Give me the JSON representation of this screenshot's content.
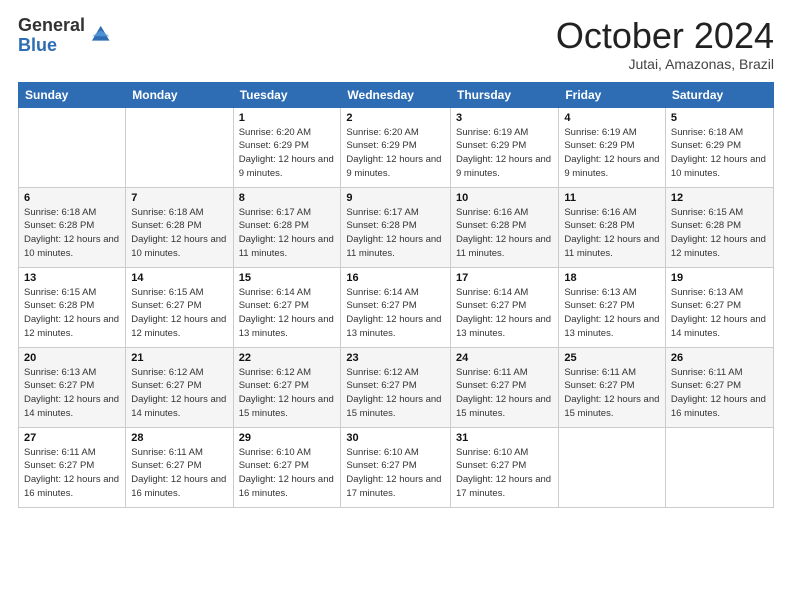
{
  "header": {
    "logo_general": "General",
    "logo_blue": "Blue",
    "month_title": "October 2024",
    "location": "Jutai, Amazonas, Brazil"
  },
  "weekdays": [
    "Sunday",
    "Monday",
    "Tuesday",
    "Wednesday",
    "Thursday",
    "Friday",
    "Saturday"
  ],
  "weeks": [
    [
      {
        "day": "",
        "info": ""
      },
      {
        "day": "",
        "info": ""
      },
      {
        "day": "1",
        "info": "Sunrise: 6:20 AM\nSunset: 6:29 PM\nDaylight: 12 hours and 9 minutes."
      },
      {
        "day": "2",
        "info": "Sunrise: 6:20 AM\nSunset: 6:29 PM\nDaylight: 12 hours and 9 minutes."
      },
      {
        "day": "3",
        "info": "Sunrise: 6:19 AM\nSunset: 6:29 PM\nDaylight: 12 hours and 9 minutes."
      },
      {
        "day": "4",
        "info": "Sunrise: 6:19 AM\nSunset: 6:29 PM\nDaylight: 12 hours and 9 minutes."
      },
      {
        "day": "5",
        "info": "Sunrise: 6:18 AM\nSunset: 6:29 PM\nDaylight: 12 hours and 10 minutes."
      }
    ],
    [
      {
        "day": "6",
        "info": "Sunrise: 6:18 AM\nSunset: 6:28 PM\nDaylight: 12 hours and 10 minutes."
      },
      {
        "day": "7",
        "info": "Sunrise: 6:18 AM\nSunset: 6:28 PM\nDaylight: 12 hours and 10 minutes."
      },
      {
        "day": "8",
        "info": "Sunrise: 6:17 AM\nSunset: 6:28 PM\nDaylight: 12 hours and 11 minutes."
      },
      {
        "day": "9",
        "info": "Sunrise: 6:17 AM\nSunset: 6:28 PM\nDaylight: 12 hours and 11 minutes."
      },
      {
        "day": "10",
        "info": "Sunrise: 6:16 AM\nSunset: 6:28 PM\nDaylight: 12 hours and 11 minutes."
      },
      {
        "day": "11",
        "info": "Sunrise: 6:16 AM\nSunset: 6:28 PM\nDaylight: 12 hours and 11 minutes."
      },
      {
        "day": "12",
        "info": "Sunrise: 6:15 AM\nSunset: 6:28 PM\nDaylight: 12 hours and 12 minutes."
      }
    ],
    [
      {
        "day": "13",
        "info": "Sunrise: 6:15 AM\nSunset: 6:28 PM\nDaylight: 12 hours and 12 minutes."
      },
      {
        "day": "14",
        "info": "Sunrise: 6:15 AM\nSunset: 6:27 PM\nDaylight: 12 hours and 12 minutes."
      },
      {
        "day": "15",
        "info": "Sunrise: 6:14 AM\nSunset: 6:27 PM\nDaylight: 12 hours and 13 minutes."
      },
      {
        "day": "16",
        "info": "Sunrise: 6:14 AM\nSunset: 6:27 PM\nDaylight: 12 hours and 13 minutes."
      },
      {
        "day": "17",
        "info": "Sunrise: 6:14 AM\nSunset: 6:27 PM\nDaylight: 12 hours and 13 minutes."
      },
      {
        "day": "18",
        "info": "Sunrise: 6:13 AM\nSunset: 6:27 PM\nDaylight: 12 hours and 13 minutes."
      },
      {
        "day": "19",
        "info": "Sunrise: 6:13 AM\nSunset: 6:27 PM\nDaylight: 12 hours and 14 minutes."
      }
    ],
    [
      {
        "day": "20",
        "info": "Sunrise: 6:13 AM\nSunset: 6:27 PM\nDaylight: 12 hours and 14 minutes."
      },
      {
        "day": "21",
        "info": "Sunrise: 6:12 AM\nSunset: 6:27 PM\nDaylight: 12 hours and 14 minutes."
      },
      {
        "day": "22",
        "info": "Sunrise: 6:12 AM\nSunset: 6:27 PM\nDaylight: 12 hours and 15 minutes."
      },
      {
        "day": "23",
        "info": "Sunrise: 6:12 AM\nSunset: 6:27 PM\nDaylight: 12 hours and 15 minutes."
      },
      {
        "day": "24",
        "info": "Sunrise: 6:11 AM\nSunset: 6:27 PM\nDaylight: 12 hours and 15 minutes."
      },
      {
        "day": "25",
        "info": "Sunrise: 6:11 AM\nSunset: 6:27 PM\nDaylight: 12 hours and 15 minutes."
      },
      {
        "day": "26",
        "info": "Sunrise: 6:11 AM\nSunset: 6:27 PM\nDaylight: 12 hours and 16 minutes."
      }
    ],
    [
      {
        "day": "27",
        "info": "Sunrise: 6:11 AM\nSunset: 6:27 PM\nDaylight: 12 hours and 16 minutes."
      },
      {
        "day": "28",
        "info": "Sunrise: 6:11 AM\nSunset: 6:27 PM\nDaylight: 12 hours and 16 minutes."
      },
      {
        "day": "29",
        "info": "Sunrise: 6:10 AM\nSunset: 6:27 PM\nDaylight: 12 hours and 16 minutes."
      },
      {
        "day": "30",
        "info": "Sunrise: 6:10 AM\nSunset: 6:27 PM\nDaylight: 12 hours and 17 minutes."
      },
      {
        "day": "31",
        "info": "Sunrise: 6:10 AM\nSunset: 6:27 PM\nDaylight: 12 hours and 17 minutes."
      },
      {
        "day": "",
        "info": ""
      },
      {
        "day": "",
        "info": ""
      }
    ]
  ]
}
